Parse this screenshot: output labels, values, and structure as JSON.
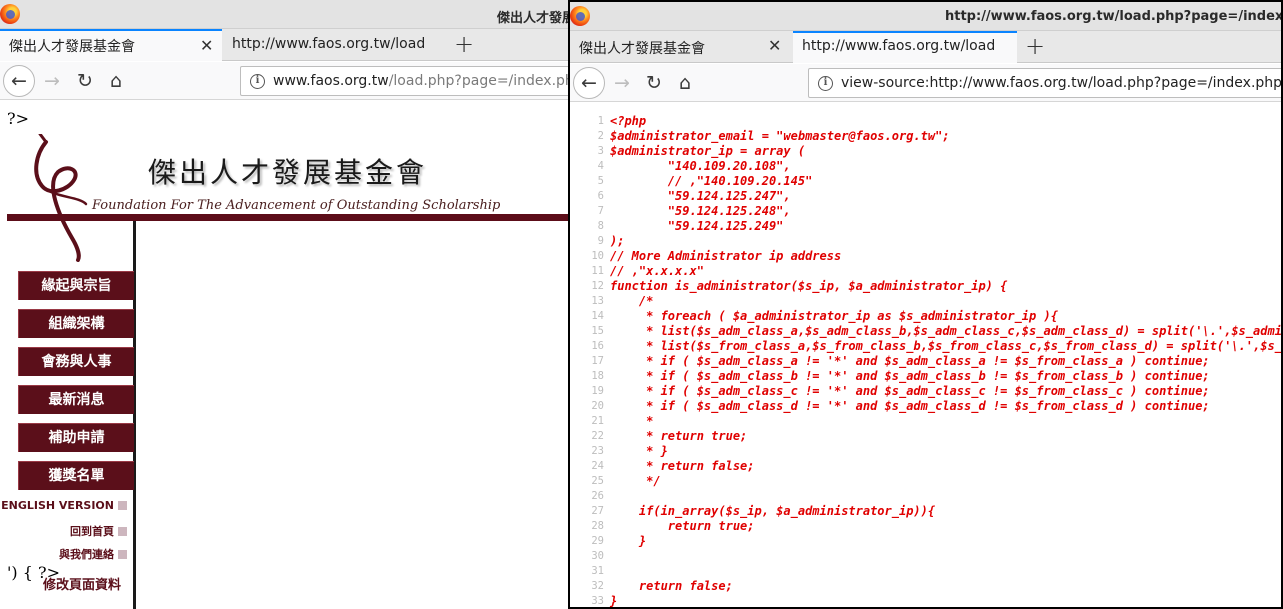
{
  "left_window": {
    "title": "傑出人才發展",
    "tabs": [
      {
        "label": "傑出人才發展基金會",
        "active": true
      },
      {
        "label": "http://www.faos.org.tw/load.p",
        "active": false
      }
    ],
    "url_host": "www.faos.org.tw",
    "url_path": "/load.php?page=/index.php",
    "stray_text_top": "?>",
    "stray_text_bottom": "') { ?>",
    "site": {
      "title_cn": "傑出人才發展基金會",
      "title_en": "Foundation For The Advancement of Outstanding Scholarship",
      "brand_color": "#5b0f1a"
    },
    "menu": [
      "緣起與宗旨",
      "組織架構",
      "會務與人事",
      "最新消息",
      "補助申請",
      "獲獎名單"
    ],
    "sub_links": [
      "ENGLISH VERSION",
      "回到首頁",
      "與我們連絡"
    ],
    "edit_link": "修改頁面資料"
  },
  "right_window": {
    "title": "http://www.faos.org.tw/load.php?page=/index.ph",
    "tabs": [
      {
        "label": "傑出人才發展基金會",
        "active": false
      },
      {
        "label": "http://www.faos.org.tw/load.p",
        "active": true
      }
    ],
    "url": "view-source:http://www.faos.org.tw/load.php?page=/index.php",
    "source_lines": [
      "<?php",
      "$administrator_email = \"webmaster@faos.org.tw\";",
      "$administrator_ip = array (",
      "        \"140.109.20.108\",",
      "        // ,\"140.109.20.145\"",
      "        \"59.124.125.247\",",
      "        \"59.124.125.248\",",
      "        \"59.124.125.249\"",
      ");",
      "// More Administrator ip address",
      "// ,\"x.x.x.x\"",
      "function is_administrator($s_ip, $a_administrator_ip) {",
      "    /*",
      "     * foreach ( $a_administrator_ip as $s_administrator_ip ){",
      "     * list($s_adm_class_a,$s_adm_class_b,$s_adm_class_c,$s_adm_class_d) = split('\\.',$s_adminis",
      "     * list($s_from_class_a,$s_from_class_b,$s_from_class_c,$s_from_class_d) = split('\\.',$s_ip);",
      "     * if ( $s_adm_class_a != '*' and $s_adm_class_a != $s_from_class_a ) continue;",
      "     * if ( $s_adm_class_b != '*' and $s_adm_class_b != $s_from_class_b ) continue;",
      "     * if ( $s_adm_class_c != '*' and $s_adm_class_c != $s_from_class_c ) continue;",
      "     * if ( $s_adm_class_d != '*' and $s_adm_class_d != $s_from_class_d ) continue;",
      "     *",
      "     * return true;",
      "     * }",
      "     * return false;",
      "     */",
      "",
      "    if(in_array($s_ip, $a_administrator_ip)){",
      "        return true;",
      "    }",
      "",
      "",
      "    return false;",
      "}"
    ]
  }
}
